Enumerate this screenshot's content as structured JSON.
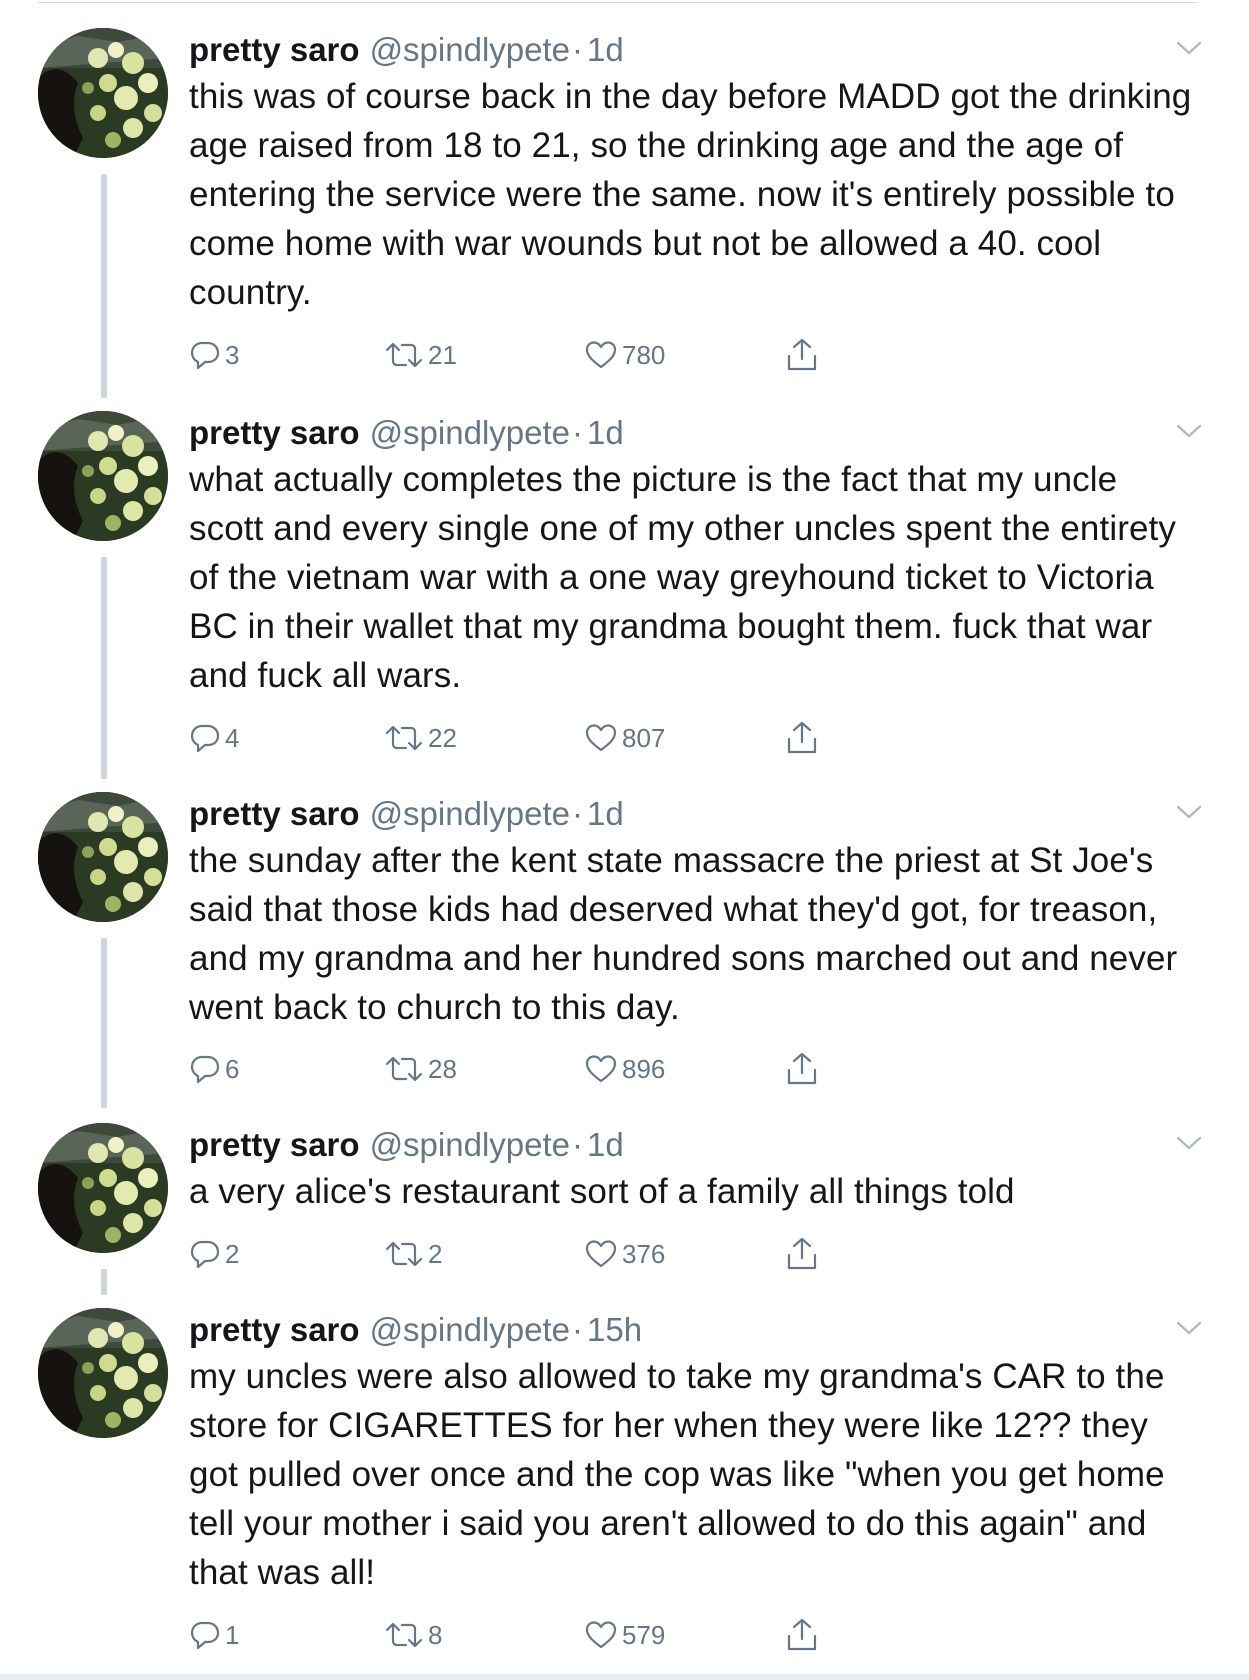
{
  "colors": {
    "text_primary": "#14171a",
    "text_secondary": "#657786",
    "thread_line": "#ccd6dd",
    "divider": "#d6dbe0"
  },
  "icons": {
    "reply": "reply-icon",
    "retweet": "retweet-icon",
    "like": "heart-icon",
    "share": "share-icon",
    "menu": "chevron-down-icon"
  },
  "tweets": [
    {
      "display_name": "pretty saro",
      "handle": "@spindlypete",
      "separator": "·",
      "time": "1d",
      "text": "this was of course back in the day before MADD got the drinking age raised from 18 to 21, so the drinking age and the age of entering the service were the same. now it's entirely possible to come home with war wounds but not be allowed a 40. cool country.",
      "replies": "3",
      "retweets": "21",
      "likes": "780"
    },
    {
      "display_name": "pretty saro",
      "handle": "@spindlypete",
      "separator": "·",
      "time": "1d",
      "text": "what actually completes the picture is the fact that my uncle scott and every single one of my other uncles spent the entirety of the vietnam war with a one way greyhound ticket to Victoria BC in their wallet that my grandma bought them. fuck that war and fuck all wars.",
      "replies": "4",
      "retweets": "22",
      "likes": "807"
    },
    {
      "display_name": "pretty saro",
      "handle": "@spindlypete",
      "separator": "·",
      "time": "1d",
      "text": "the sunday after the kent state massacre the priest at St Joe's said that those kids had deserved what they'd got, for treason, and my grandma and her hundred sons marched out and never went back to church to this day.",
      "replies": "6",
      "retweets": "28",
      "likes": "896"
    },
    {
      "display_name": "pretty saro",
      "handle": "@spindlypete",
      "separator": "·",
      "time": "1d",
      "text": "a very alice's restaurant sort of a family all things told",
      "replies": "2",
      "retweets": "2",
      "likes": "376"
    },
    {
      "display_name": "pretty saro",
      "handle": "@spindlypete",
      "separator": "·",
      "time": "15h",
      "text": "my uncles were also allowed to take my grandma's CAR to the store for CIGARETTES for her when they were like 12?? they got pulled over once and the cop was like \"when you get home tell your mother i said you aren't allowed to do this again\" and that was all!",
      "replies": "1",
      "retweets": "8",
      "likes": "579"
    }
  ]
}
